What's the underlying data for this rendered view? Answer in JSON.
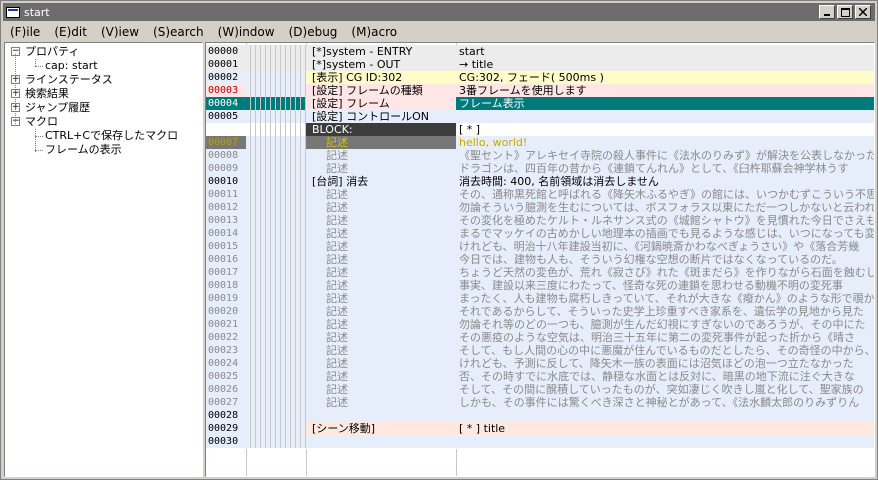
{
  "window": {
    "title": "start"
  },
  "menu": [
    "(F)ile",
    "(E)dit",
    "(V)iew",
    "(S)earch",
    "(W)indow",
    "(D)ebug",
    "(M)acro"
  ],
  "tree": [
    {
      "label": "プロパティ",
      "level": 0,
      "expander": "−"
    },
    {
      "label": "cap: start",
      "level": 1,
      "expander": ""
    },
    {
      "label": "ラインステータス",
      "level": 0,
      "expander": "+"
    },
    {
      "label": "検索結果",
      "level": 0,
      "expander": "+"
    },
    {
      "label": "ジャンプ履歴",
      "level": 0,
      "expander": "+"
    },
    {
      "label": "マクロ",
      "level": 0,
      "expander": "−"
    },
    {
      "label": "CTRL+Cで保存したマクロ",
      "level": 1,
      "expander": ""
    },
    {
      "label": "フレームの表示",
      "level": 1,
      "expander": ""
    }
  ],
  "rows": [
    {
      "num": "00000",
      "cmd": "[*]system -  ENTRY",
      "arg": "start",
      "style": "system"
    },
    {
      "num": "00001",
      "cmd": "[*]system -  OUT",
      "arg": "→ title",
      "style": "system"
    },
    {
      "num": "00002",
      "cmd": "[表示] CG ID:302",
      "arg": "CG:302, フェード( 500ms )",
      "style": "display"
    },
    {
      "num": "00003",
      "cmd": "[設定] フレームの種類",
      "arg": "3番フレームを使用します",
      "style": "setting-red"
    },
    {
      "num": "00004",
      "cmd": "[設定] フレーム",
      "arg": "フレーム表示",
      "style": "selected"
    },
    {
      "num": "00005",
      "cmd": "[設定] コントロールON",
      "arg": "",
      "style": "setting"
    },
    {
      "num": "",
      "cmd": "BLOCK:",
      "arg": "[ * ]",
      "style": "block"
    },
    {
      "num": "00007",
      "cmd": "記述",
      "arg": "hello, world!",
      "style": "disabled"
    },
    {
      "num": "00008",
      "cmd": "記述",
      "arg": "《聖セント》アレキセイ寺院の殺人事件に《法水のりみず》が解決を公表しなかった",
      "style": "text"
    },
    {
      "num": "00009",
      "cmd": "記述",
      "arg": "ドラゴンは、四百年の昔から《連鎖てんれん》として、《臼杵耶蘇会神学林うす",
      "style": "text"
    },
    {
      "num": "00010",
      "cmd": "[台詞] 消去",
      "arg": "消去時間: 400, 名前領域は消去しません",
      "style": "dialog"
    },
    {
      "num": "00011",
      "cmd": "記述",
      "arg": "その、通称黒死館と呼ばれる《降矢木ふるやぎ》の館には、いつかむずこういう不思",
      "style": "text"
    },
    {
      "num": "00012",
      "cmd": "記述",
      "arg": "勿論そういう臆測を生むについては、ボスフォラス以東にただ一つしかないと云われ",
      "style": "text"
    },
    {
      "num": "00013",
      "cmd": "記述",
      "arg": "その変化を極めたケルト・ルネサンス式の《城館シャトウ》を見慣れた今日でさえも、",
      "style": "text"
    },
    {
      "num": "00014",
      "cmd": "記述",
      "arg": "まるでマッケイの古めかしい地理本の插画でも見るような感じは、いつになっても変ら",
      "style": "text"
    },
    {
      "num": "00015",
      "cmd": "記述",
      "arg": "けれども、明治十八年建設当初に、《河鍋暁斎かわなべぎょうさい》や《落合芳幾",
      "style": "text"
    },
    {
      "num": "00016",
      "cmd": "記述",
      "arg": "今日では、建物も人も、そういう幻権な空想の断片ではなくなっているのだ。",
      "style": "text"
    },
    {
      "num": "00017",
      "cmd": "記述",
      "arg": "ちょうど天然の変色が、荒れ《寂さび》れた《斑まだら》を作りながら石面を蝕むし",
      "style": "text"
    },
    {
      "num": "00018",
      "cmd": "記述",
      "arg": "事実、建設以来三度にわたって、怪奇な死の連鎖を思わせる動機不明の変死事",
      "style": "text"
    },
    {
      "num": "00019",
      "cmd": "記述",
      "arg": "まったく、人も建物も腐朽しきっていて、それが大きな《癈かん》のような形で覗かれ",
      "style": "text"
    },
    {
      "num": "00020",
      "cmd": "記述",
      "arg": "それであるからして、そういった史学上珍重すべき家系を、遺伝学の見地から見た",
      "style": "text"
    },
    {
      "num": "00021",
      "cmd": "記述",
      "arg": "勿論それ等のどの一つも、臆測が生んだ幻視にすぎないのであろうが、その中にた",
      "style": "text"
    },
    {
      "num": "00022",
      "cmd": "記述",
      "arg": "その悪疫のような空気は、明治三十五年に第二の変死事件が起った折から《晴さ",
      "style": "text"
    },
    {
      "num": "00023",
      "cmd": "記述",
      "arg": "そして、もし人間の心の中に悪魔が住んでいるものだとしたら、その奇怪の中から、",
      "style": "text"
    },
    {
      "num": "00024",
      "cmd": "記述",
      "arg": "けれども、予測に反して、降矢木一族の表面には沼気ほどの泡一つ立たなかった",
      "style": "text"
    },
    {
      "num": "00025",
      "cmd": "記述",
      "arg": "否、その時すでに水底では、静穏な水面とは反対に、暗黒の地下流に注ぐ大きな",
      "style": "text"
    },
    {
      "num": "00026",
      "cmd": "記述",
      "arg": "そして、その間に醗積していったものが、突如凄じく吹きし嵐と化して、聖家族の",
      "style": "text"
    },
    {
      "num": "00027",
      "cmd": "記述",
      "arg": "しかも、その事件には驚くべき深さと神秘とがあって、《法水麟太郎のりみずりん",
      "style": "text"
    },
    {
      "num": "00028",
      "cmd": "",
      "arg": "",
      "style": "empty"
    },
    {
      "num": "00029",
      "cmd": "[シーン移動]",
      "arg": "[ * ] title",
      "style": "scene"
    },
    {
      "num": "00030",
      "cmd": "",
      "arg": "",
      "style": "empty"
    }
  ],
  "colors": {
    "title_bg": "#6d6d6d",
    "row_bg": "#e6eefb",
    "selected_bg": "#007b7b",
    "block_bg": "#3c3c3c",
    "disabled_bg": "#777777",
    "display_bg": "#fffcc8",
    "setting_red_bg": "#ffe6e6",
    "scene_bg": "#ffe8e0"
  }
}
